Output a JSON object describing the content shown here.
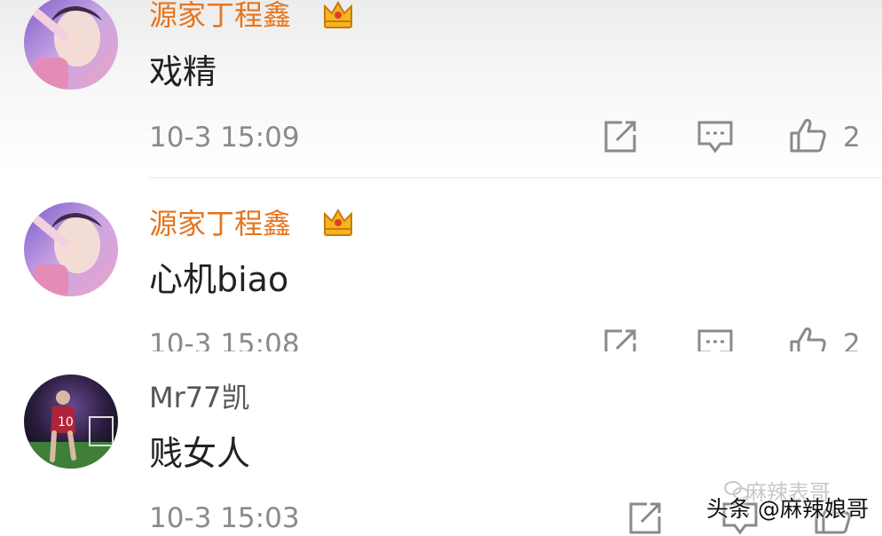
{
  "colors": {
    "username_vip": "#e6751e",
    "username": "#555555",
    "timestamp": "#8a8a8a",
    "text": "#222222"
  },
  "comments": [
    {
      "username": "源家丁程鑫",
      "vip_badge": "crown-icon",
      "text": "戏精",
      "time": "10-3 15:09",
      "likes": "2"
    },
    {
      "username": "源家丁程鑫",
      "vip_badge": "crown-icon",
      "text": "心机biao",
      "time": "10-3 15:08",
      "likes": "2"
    },
    {
      "username": "Mr77凯",
      "text": "贱女人",
      "time": "10-3 15:03"
    }
  ],
  "icons": {
    "share": "share-icon",
    "reply": "comment-icon",
    "like": "thumbs-up-icon"
  },
  "watermark": {
    "text": "头条 @麻辣娘哥",
    "faint_text": "麻辣表哥"
  }
}
